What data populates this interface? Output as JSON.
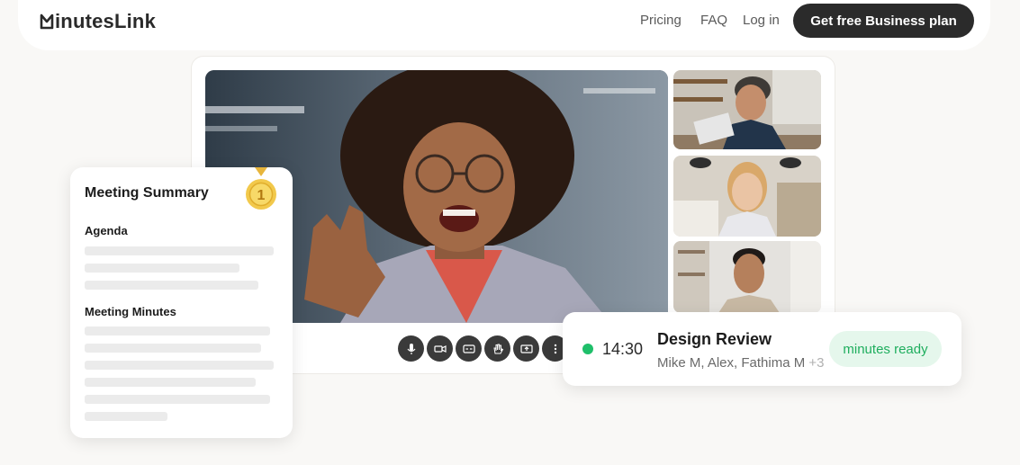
{
  "nav": {
    "logo_text": "inutesLink",
    "links": [
      "Pricing",
      "FAQ",
      "Log in"
    ],
    "cta_label": "Get free Business plan"
  },
  "video": {
    "control_icons": [
      "microphone-icon",
      "camera-icon",
      "captions-icon",
      "raise-hand-icon",
      "share-screen-icon",
      "more-icon"
    ]
  },
  "summary_card": {
    "title": "Meeting Summary",
    "section_agenda": "Agenda",
    "section_minutes": "Meeting Minutes",
    "medal_number": "1"
  },
  "meeting_card": {
    "time": "14:30",
    "title": "Design Review",
    "participants": "Mike M, Alex, Fathima M",
    "extra_count": "+3",
    "status": "minutes ready",
    "status_color": "#1fae5e"
  },
  "colors": {
    "background": "#f9f8f6",
    "cta": "#2b2b2b",
    "live_dot": "#1fbf6a",
    "medal": "#f2c94c"
  }
}
